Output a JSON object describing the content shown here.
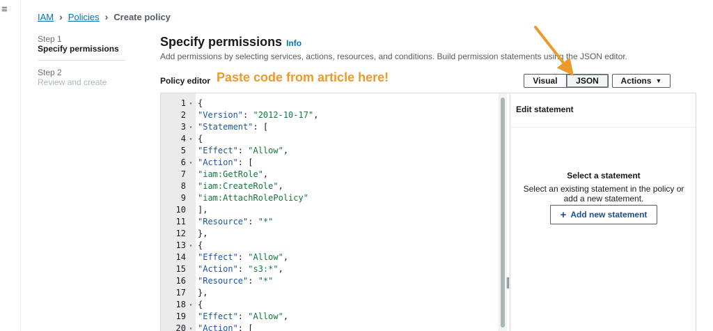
{
  "nav": {
    "menu_icon": "hamburger-icon",
    "menu_glyph": "≡"
  },
  "breadcrumb": {
    "items": [
      "IAM",
      "Policies"
    ],
    "current": "Create policy",
    "separator": "›"
  },
  "steps": [
    {
      "label": "Step 1",
      "title": "Specify permissions"
    },
    {
      "label": "Step 2",
      "title": "Review and create"
    }
  ],
  "header": {
    "title": "Specify permissions",
    "info": "Info",
    "description": "Add permissions by selecting services, actions, resources, and conditions. Build permission statements using the JSON editor."
  },
  "policy_editor": {
    "label": "Policy editor",
    "annotation": "Paste code from article here!",
    "annotation_color": "#ec9a29",
    "buttons": {
      "visual": "Visual",
      "json": "JSON",
      "actions": "Actions"
    }
  },
  "code_lines": [
    {
      "n": "1",
      "fold": true,
      "html": "{"
    },
    {
      "n": "2",
      "fold": false,
      "html": "<span class=\"k\">\"Version\"</span>: <span class=\"s\">\"2012-10-17\"</span>,"
    },
    {
      "n": "3",
      "fold": true,
      "html": "<span class=\"k\">\"Statement\"</span>: ["
    },
    {
      "n": "4",
      "fold": true,
      "html": "{"
    },
    {
      "n": "5",
      "fold": false,
      "html": "<span class=\"k\">\"Effect\"</span>: <span class=\"s\">\"Allow\"</span>,"
    },
    {
      "n": "6",
      "fold": true,
      "html": "<span class=\"k\">\"Action\"</span>: ["
    },
    {
      "n": "7",
      "fold": false,
      "html": "<span class=\"s\">\"iam:GetRole\"</span>,"
    },
    {
      "n": "8",
      "fold": false,
      "html": "<span class=\"s\">\"iam:CreateRole\"</span>,"
    },
    {
      "n": "9",
      "fold": false,
      "html": "<span class=\"s\">\"iam:AttachRolePolicy\"</span>"
    },
    {
      "n": "10",
      "fold": false,
      "html": "],"
    },
    {
      "n": "11",
      "fold": false,
      "html": "<span class=\"k\">\"Resource\"</span>: <span class=\"s\">\"*\"</span>"
    },
    {
      "n": "12",
      "fold": false,
      "html": "},"
    },
    {
      "n": "13",
      "fold": true,
      "html": "{"
    },
    {
      "n": "14",
      "fold": false,
      "html": "<span class=\"k\">\"Effect\"</span>: <span class=\"s\">\"Allow\"</span>,"
    },
    {
      "n": "15",
      "fold": false,
      "html": "<span class=\"k\">\"Action\"</span>: <span class=\"s\">\"s3:*\"</span>,"
    },
    {
      "n": "16",
      "fold": false,
      "html": "<span class=\"k\">\"Resource\"</span>: <span class=\"s\">\"*\"</span>"
    },
    {
      "n": "17",
      "fold": false,
      "html": "},"
    },
    {
      "n": "18",
      "fold": true,
      "html": "{"
    },
    {
      "n": "19",
      "fold": false,
      "html": "<span class=\"k\">\"Effect\"</span>: <span class=\"s\">\"Allow\"</span>,"
    },
    {
      "n": "20",
      "fold": true,
      "html": "<span class=\"k\">\"Action\"</span>: ["
    }
  ],
  "side_panel": {
    "heading": "Edit statement",
    "title": "Select a statement",
    "text": "Select an existing statement in the policy or add a new statement.",
    "add_button": "Add new statement"
  }
}
